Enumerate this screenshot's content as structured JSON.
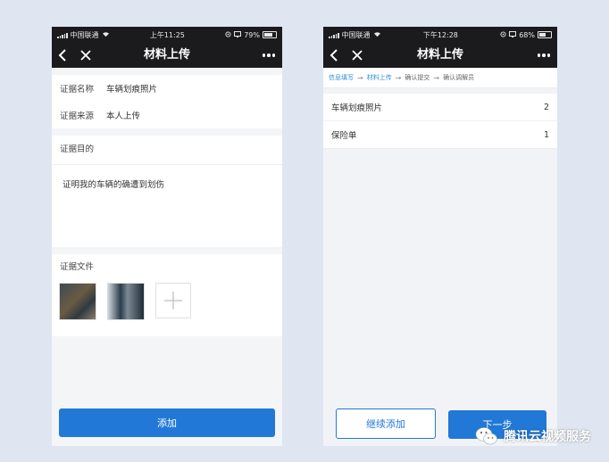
{
  "left_screen": {
    "status": {
      "carrier": "中国联通",
      "time": "上午11:25",
      "battery": "79%"
    },
    "nav": {
      "title": "材料上传"
    },
    "evidence_name": {
      "label": "证据名称",
      "value": "车辆划痕照片"
    },
    "evidence_source": {
      "label": "证据来源",
      "value": "本人上传"
    },
    "purpose": {
      "label": "证据目的",
      "text": "证明我的车辆的确遭到划伤"
    },
    "files": {
      "label": "证据文件"
    },
    "add_button": "添加"
  },
  "right_screen": {
    "status": {
      "carrier": "中国联通",
      "time": "下午12:28",
      "battery": "68%"
    },
    "nav": {
      "title": "材料上传"
    },
    "steps": [
      "信息填写",
      "材料上传",
      "确认提交",
      "确认调解员"
    ],
    "materials": [
      {
        "name": "车辆划痕照片",
        "count": "2"
      },
      {
        "name": "保险单",
        "count": "1"
      }
    ],
    "continue_button": "继续添加",
    "next_button": "下一步"
  },
  "watermark": {
    "text": "腾讯云视频服务"
  },
  "colors": {
    "accent": "#2178d6",
    "step_active": "#2e8fd8",
    "header": "#1b1b1d"
  }
}
